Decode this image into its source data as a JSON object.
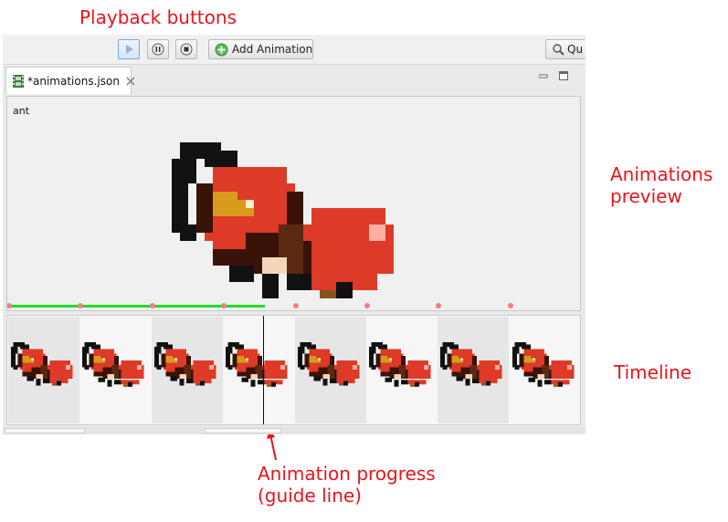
{
  "annotations": {
    "playback_buttons": "Playback buttons",
    "animations_preview": "Animations\npreview",
    "timeline": "Timeline",
    "animation_progress": "Animation progress\n(guide line)"
  },
  "toolbar": {
    "add_animation_label": "Add Animation",
    "quick_access_label": "Qu"
  },
  "editor": {
    "tab_title": "*animations.json"
  },
  "preview": {
    "animation_name": "ant"
  },
  "playback": {
    "progress_fraction": 0.45,
    "keyframe_count": 8
  },
  "timeline": {
    "frame_count": 8
  },
  "icons": {
    "play": "play-icon",
    "pause": "pause-icon",
    "stop": "stop-icon",
    "add": "add-icon",
    "search": "search-icon",
    "file": "film-file-icon",
    "close": "close-icon",
    "minimize": "minimize-icon",
    "maximize": "maximize-icon"
  },
  "colors": {
    "annotation": "#e8141c",
    "progress": "#22dd22",
    "keyframe": "#f08080",
    "ant_red": "#dd3a28",
    "ant_dark": "#3a1208",
    "ant_eye": "#d89a1c"
  }
}
